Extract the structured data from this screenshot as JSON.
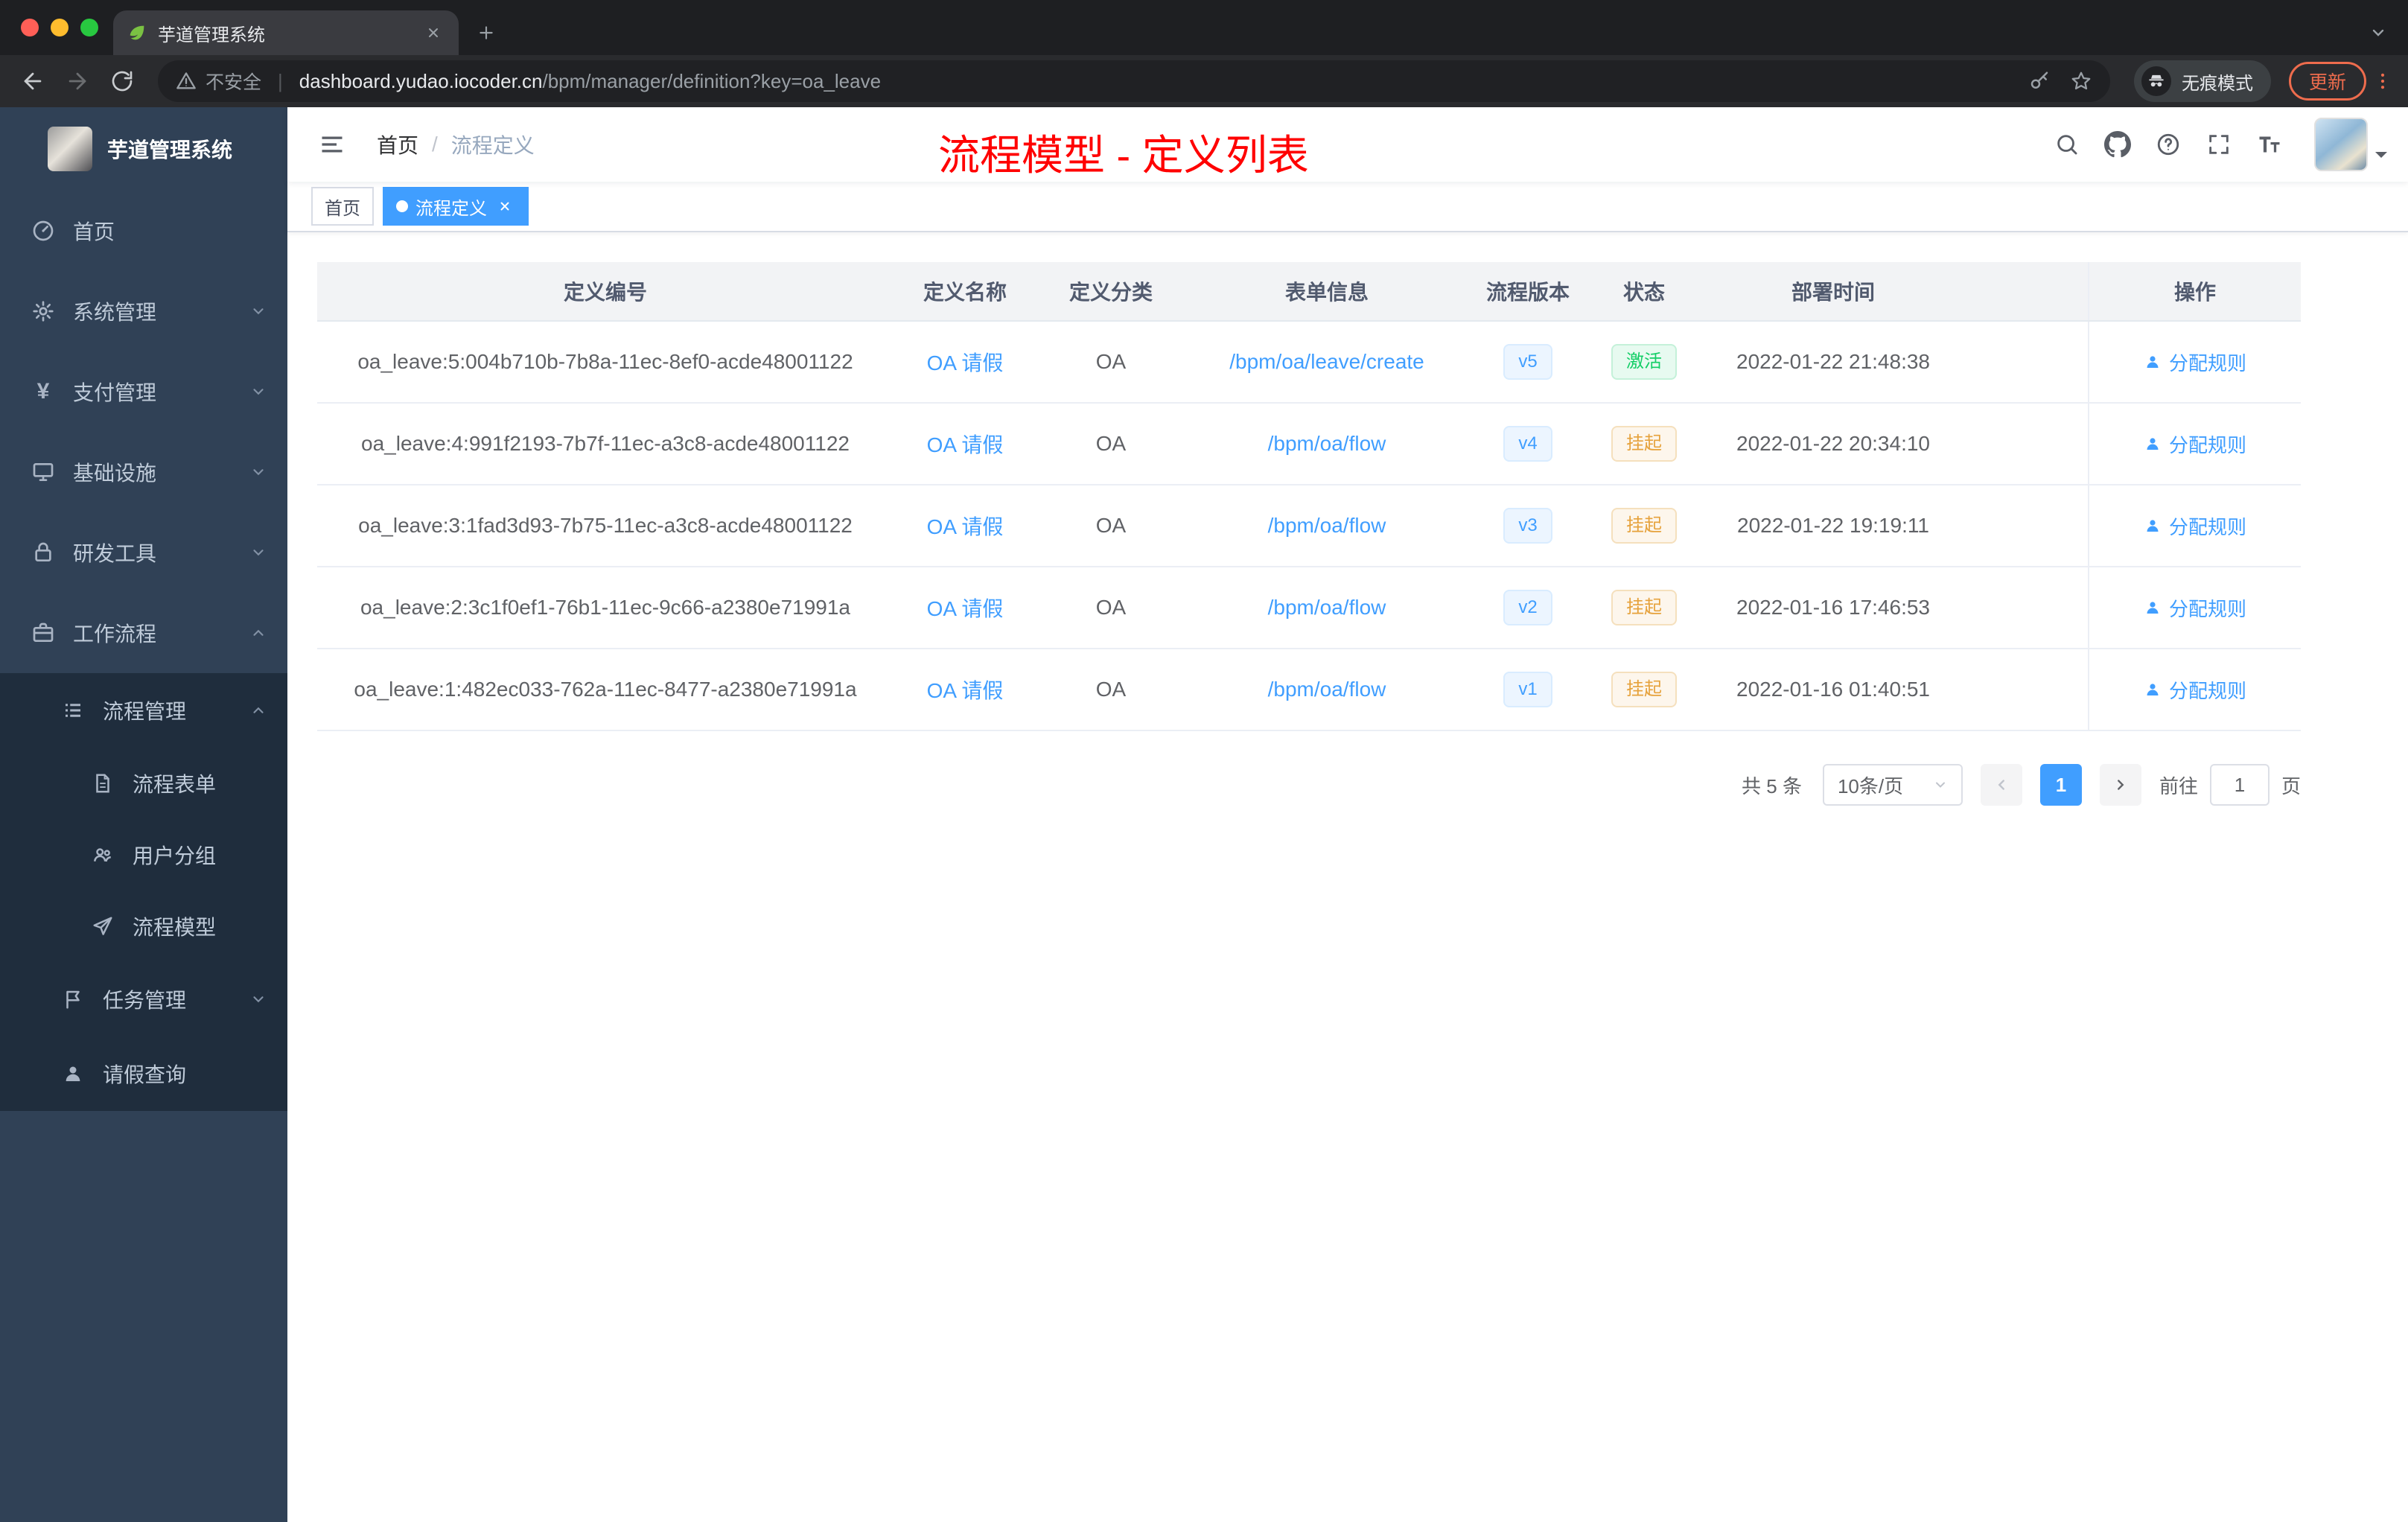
{
  "browser": {
    "tab_title": "芋道管理系统",
    "security_label": "不安全",
    "url_host": "dashboard.yudao.iocoder.cn",
    "url_path": "/bpm/manager/definition?key=oa_leave",
    "incognito_label": "无痕模式",
    "update_label": "更新"
  },
  "sidebar": {
    "logo_title": "芋道管理系统",
    "items": [
      {
        "label": "首页"
      },
      {
        "label": "系统管理"
      },
      {
        "label": "支付管理"
      },
      {
        "label": "基础设施"
      },
      {
        "label": "研发工具"
      },
      {
        "label": "工作流程"
      },
      {
        "label": "流程管理"
      },
      {
        "label": "流程表单"
      },
      {
        "label": "用户分组"
      },
      {
        "label": "流程模型"
      },
      {
        "label": "任务管理"
      },
      {
        "label": "请假查询"
      }
    ],
    "yen_glyph": "¥"
  },
  "navbar": {
    "breadcrumb_home": "首页",
    "breadcrumb_sep": "/",
    "breadcrumb_current": "流程定义",
    "annotation": "流程模型 - 定义列表"
  },
  "tags": {
    "home": "首页",
    "active": "流程定义"
  },
  "table": {
    "headers": {
      "id": "定义编号",
      "name": "定义名称",
      "category": "定义分类",
      "form": "表单信息",
      "version": "流程版本",
      "status": "状态",
      "deploy_time": "部署时间",
      "actions": "操作"
    },
    "action_label": "分配规则",
    "rows": [
      {
        "id": "oa_leave:5:004b710b-7b8a-11ec-8ef0-acde48001122",
        "name": "OA 请假",
        "category": "OA",
        "form": "/bpm/oa/leave/create",
        "version": "v5",
        "status": "激活",
        "deploy_time": "2022-01-22 21:48:38"
      },
      {
        "id": "oa_leave:4:991f2193-7b7f-11ec-a3c8-acde48001122",
        "name": "OA 请假",
        "category": "OA",
        "form": "/bpm/oa/flow",
        "version": "v4",
        "status": "挂起",
        "deploy_time": "2022-01-22 20:34:10"
      },
      {
        "id": "oa_leave:3:1fad3d93-7b75-11ec-a3c8-acde48001122",
        "name": "OA 请假",
        "category": "OA",
        "form": "/bpm/oa/flow",
        "version": "v3",
        "status": "挂起",
        "deploy_time": "2022-01-22 19:19:11"
      },
      {
        "id": "oa_leave:2:3c1f0ef1-76b1-11ec-9c66-a2380e71991a",
        "name": "OA 请假",
        "category": "OA",
        "form": "/bpm/oa/flow",
        "version": "v2",
        "status": "挂起",
        "deploy_time": "2022-01-16 17:46:53"
      },
      {
        "id": "oa_leave:1:482ec033-762a-11ec-8477-a2380e71991a",
        "name": "OA 请假",
        "category": "OA",
        "form": "/bpm/oa/flow",
        "version": "v1",
        "status": "挂起",
        "deploy_time": "2022-01-16 01:40:51"
      }
    ]
  },
  "pagination": {
    "total": "共 5 条",
    "page_size": "10条/页",
    "current_page": "1",
    "goto_label": "前往",
    "goto_value": "1",
    "page_unit": "页"
  },
  "colors": {
    "accent": "#409eff",
    "annotation_red": "#ff0000",
    "status_active": "#13ce66",
    "status_suspend": "#e6a23c",
    "sidebar_bg": "#304156",
    "submenu_bg": "#1f2d3d"
  }
}
